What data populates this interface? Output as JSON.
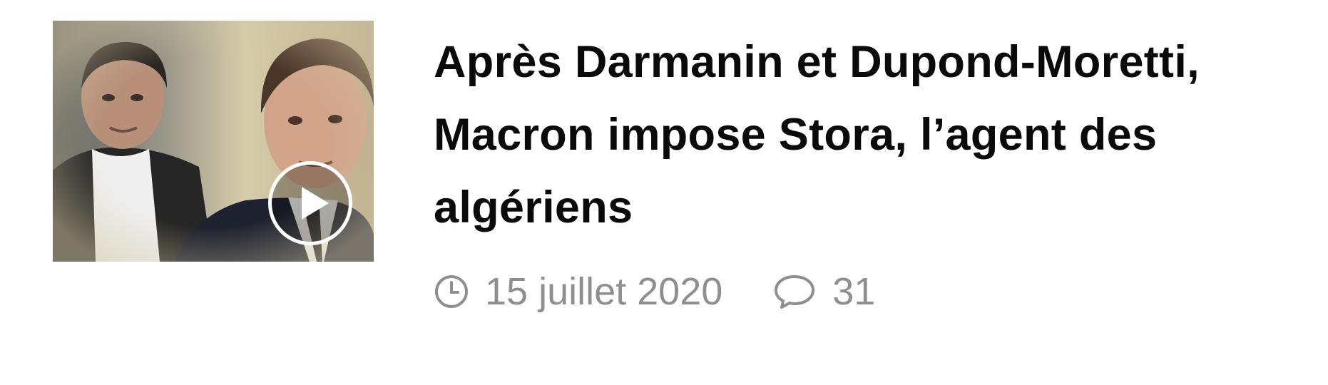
{
  "post": {
    "title": "Après Darmanin et Dupond-Moretti, Macron impose Stora, l’agent des algériens",
    "date": "15 juillet 2020",
    "comment_count": "31",
    "thumbnail": {
      "has_video": true
    },
    "icons": {
      "date": "clock-icon",
      "comments": "speech-bubble-icon",
      "video": "play-icon"
    },
    "colors": {
      "title": "#0a0a0a",
      "meta": "#8f8f8f",
      "background": "#ffffff"
    }
  }
}
